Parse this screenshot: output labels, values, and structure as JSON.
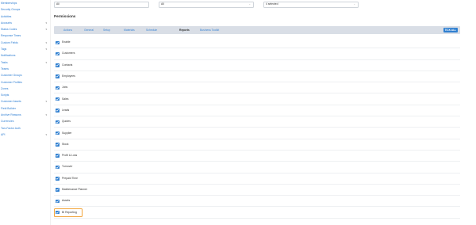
{
  "sidebar": {
    "items": [
      {
        "label": "Memberships",
        "chevron": false
      },
      {
        "label": "Security Groups",
        "chevron": false
      },
      {
        "label": "Activities",
        "chevron": false
      },
      {
        "label": "Accounts",
        "chevron": true
      },
      {
        "label": "Status Codes",
        "chevron": true
      },
      {
        "label": "Response Times",
        "chevron": false
      },
      {
        "label": "Custom Fields",
        "chevron": true
      },
      {
        "label": "Tags",
        "chevron": true
      },
      {
        "label": "Notifications",
        "chevron": false
      },
      {
        "label": "Tasks",
        "chevron": true
      },
      {
        "label": "Teams",
        "chevron": false
      },
      {
        "label": "Customer Groups",
        "chevron": false
      },
      {
        "label": "Customer Profiles",
        "chevron": false
      },
      {
        "label": "Zones",
        "chevron": false
      },
      {
        "label": "Scripts",
        "chevron": false
      },
      {
        "label": "Customer Assets",
        "chevron": true
      },
      {
        "label": "Field Builder",
        "chevron": false
      },
      {
        "label": "Archive Reasons",
        "chevron": true
      },
      {
        "label": "Currencies",
        "chevron": false
      },
      {
        "label": "Two-Factor Auth",
        "chevron": false
      },
      {
        "label": "API",
        "chevron": true
      }
    ]
  },
  "filters": {
    "first": "All",
    "second": "All",
    "third": "4 selected"
  },
  "permissions_title": "Permissions",
  "tabs": [
    {
      "label": "Actions",
      "active": false
    },
    {
      "label": "General",
      "active": false
    },
    {
      "label": "Setup",
      "active": false
    },
    {
      "label": "Materials",
      "active": false
    },
    {
      "label": "Schedule",
      "active": false
    },
    {
      "label": "Reports",
      "active": true
    },
    {
      "label": "Business Toolkit",
      "active": false
    }
  ],
  "tick_all_label": "TICK ALL",
  "permissions": [
    {
      "label": "Enable",
      "checked": true
    },
    {
      "label": "Customers",
      "checked": true
    },
    {
      "label": "Contacts",
      "checked": true
    },
    {
      "label": "Employees",
      "checked": true
    },
    {
      "label": "Jobs",
      "checked": true
    },
    {
      "label": "Sales",
      "checked": true
    },
    {
      "label": "Leads",
      "checked": true
    },
    {
      "label": "Quotes",
      "checked": true
    },
    {
      "label": "Supplier",
      "checked": true
    },
    {
      "label": "Stock",
      "checked": true
    },
    {
      "label": "Profit & Loss",
      "checked": true
    },
    {
      "label": "Turnover",
      "checked": true
    },
    {
      "label": "Prepaid Time",
      "checked": true
    },
    {
      "label": "Maintenance Planner",
      "checked": true
    },
    {
      "label": "Assets",
      "checked": true
    },
    {
      "label": "BI Reporting",
      "checked": true,
      "highlighted": true
    }
  ],
  "colors": {
    "accent": "#2f7fd0",
    "link": "#2d7dd2",
    "tabbar": "#d9dee6",
    "highlight": "#f2a43a"
  }
}
